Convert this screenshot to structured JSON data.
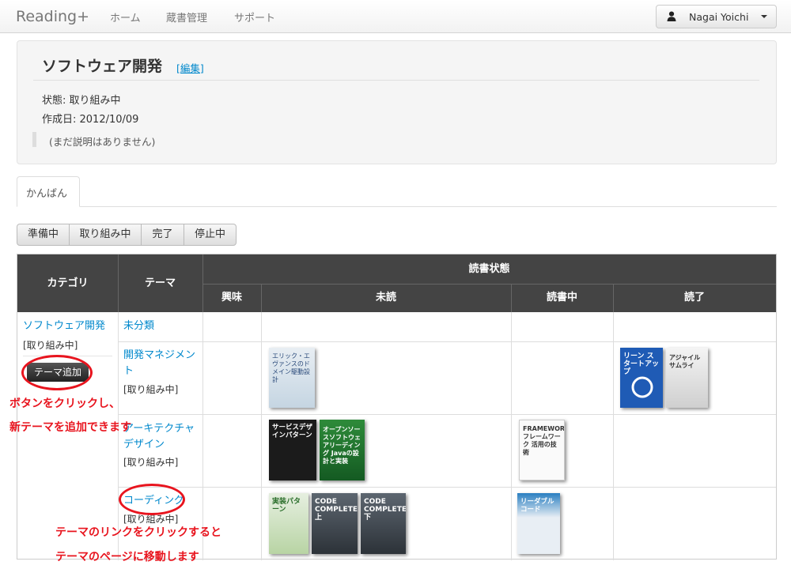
{
  "navbar": {
    "brand": "Reading+",
    "links": [
      "ホーム",
      "蔵書管理",
      "サポート"
    ],
    "user_icon": "user-icon",
    "user_name": "Nagai Yoichi"
  },
  "project": {
    "title": "ソフトウェア開発",
    "edit_label": "[編集]",
    "status_line": "状態: 取り組み中",
    "created_line": "作成日: 2012/10/09",
    "description": "(まだ説明はありません)"
  },
  "tabs": [
    "かんばん"
  ],
  "filters": [
    "準備中",
    "取り組み中",
    "完了",
    "停止中"
  ],
  "kanban": {
    "headers": {
      "category": "カテゴリ",
      "theme": "テーマ",
      "reading_status": "読書状態",
      "interest": "興味",
      "unread": "未読",
      "reading": "読書中",
      "done": "読了"
    },
    "category": {
      "name": "ソフトウェア開発",
      "status": "[取り組み中]",
      "add_theme_label": "テーマ追加"
    },
    "themes": [
      {
        "name": "未分類",
        "status": ""
      },
      {
        "name": "開発マネジメント",
        "status": "[取り組み中]"
      },
      {
        "name": "アーキテクチャデザイン",
        "status": "[取り組み中]"
      },
      {
        "name": "コーディング",
        "status": "[取り組み中]"
      }
    ],
    "books": {
      "management_unread": [
        "エリック・エヴァンスのドメイン駆動設計"
      ],
      "management_done": [
        "リーン スタートアップ",
        "アジャイルサムライ"
      ],
      "architecture_unread": [
        "サービスデザインパターン",
        "オープンソースソフトウェアリーディング Javaの設計と実装"
      ],
      "architecture_reading": [
        "FRAMEWORK フレームワーク 活用の技術"
      ],
      "coding_unread": [
        "実装パターン",
        "CODE COMPLETE 上",
        "CODE COMPLETE 下"
      ],
      "coding_reading": [
        "リーダブルコード"
      ]
    }
  },
  "annotations": {
    "add_button_line1": "ボタンをクリックし、",
    "add_button_line2": "新テーマを追加できます",
    "theme_link_line1": "テーマのリンクをクリックすると",
    "theme_link_line2": "テーマのページに移動します"
  },
  "colors": {
    "link": "#0088cc",
    "header_bg": "#444444",
    "annotation_red": "#e8141e"
  }
}
